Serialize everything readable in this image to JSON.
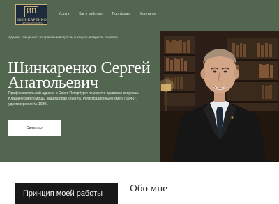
{
  "logo": {
    "mark": "ИП",
    "name": "ШИНКАРЕНКО",
    "sub": "СЕРГЕЙ АНАТОЛЬЕВИЧ"
  },
  "nav": [
    "Услуги",
    "Как я работаю",
    "Портфолио",
    "Контакты"
  ],
  "hero": {
    "lead": "Адвокат, специалист по правовым вопросам и защите интересов клиентов.",
    "title": "Шинкаренко Сергей Анатольевич",
    "description": "Профессиональный адвокат в Санкт-Петербурге поможет в правовых вопросах. Юридическая помощь, защита прав клиента. Регистрационный номер 78/8457, удостоверение № 10891",
    "cta_label": "Связаться"
  },
  "sections": {
    "principle_card": "Принцип моей работы",
    "about_title": "Обо мне"
  },
  "colors": {
    "hero_bg": "#53664f",
    "logo_bg": "#1d2b3a",
    "logo_gold": "#c7b37a",
    "card_dark": "#191919"
  }
}
